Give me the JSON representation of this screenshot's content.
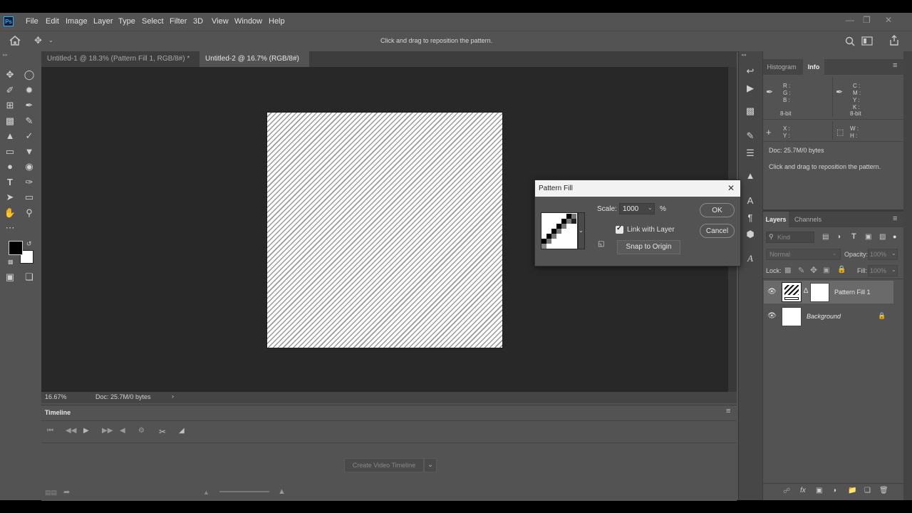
{
  "menu": [
    "File",
    "Edit",
    "Image",
    "Layer",
    "Type",
    "Select",
    "Filter",
    "3D",
    "View",
    "Window",
    "Help"
  ],
  "logo": "Ps",
  "options_hint": "Click and drag to reposition the pattern.",
  "tabs": [
    {
      "label": "Untitled-1 @ 18.3% (Pattern Fill 1, RGB/8#) *"
    },
    {
      "label": "Untitled-2 @ 16.7% (RGB/8#)"
    }
  ],
  "status": {
    "zoom": "16.67%",
    "doc": "Doc: 25.7M/0 bytes"
  },
  "timeline": {
    "tab": "Timeline",
    "create_button": "Create Video Timeline"
  },
  "info_panel": {
    "tabs": [
      "Histogram",
      "Info"
    ],
    "rgb": [
      "R :",
      "G :",
      "B :"
    ],
    "cmyk": [
      "C :",
      "M :",
      "Y :",
      "K :"
    ],
    "bit_left": "8-bit",
    "bit_right": "8-bit",
    "xy": [
      "X :",
      "Y :"
    ],
    "wh": [
      "W :",
      "H :"
    ],
    "doc": "Doc: 25.7M/0 bytes",
    "hint": "Click and drag to reposition the pattern."
  },
  "layers_panel": {
    "tabs": [
      "Layers",
      "Channels"
    ],
    "kind_placeholder": "Kind",
    "blend_mode": "Normal",
    "opacity_label": "Opacity:",
    "opacity_value": "100%",
    "lock_label": "Lock:",
    "fill_label": "Fill:",
    "fill_value": "100%",
    "layers": [
      {
        "name": "Pattern Fill 1",
        "selected": true
      },
      {
        "name": "Background",
        "selected": false
      }
    ]
  },
  "dialog": {
    "title": "Pattern Fill",
    "scale_label": "Scale:",
    "scale_value": "1000",
    "scale_unit": "%",
    "link_label": "Link with Layer",
    "link_checked": true,
    "snap_button": "Snap to Origin",
    "ok": "OK",
    "cancel": "Cancel"
  },
  "colors": {
    "accent": "#31a8ff",
    "ui": "#535353",
    "canvas": "#282828"
  }
}
